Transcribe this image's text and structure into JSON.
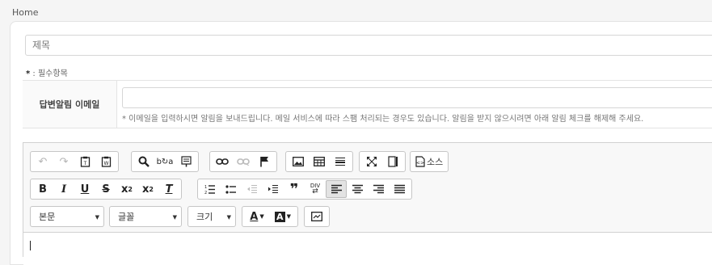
{
  "breadcrumb": {
    "home": "Home"
  },
  "form": {
    "title_placeholder": "제목",
    "required_star": "*",
    "required_text": ": 필수항목",
    "email_label": "답변알림 이메일",
    "email_hint": "* 이메일을 입력하시면 알림을 보내드립니다. 메일 서비스에 따라 스팸 처리되는 경우도 있습니다. 알림을 받지 않으시려면 아래 알림 체크를 해제해 주세요."
  },
  "editor": {
    "source_label": "소스",
    "format_combo": "본문",
    "font_combo": "글꼴",
    "size_combo": "크기",
    "text_color_glyph": "A",
    "bg_color_glyph": "A",
    "icons": {
      "bold": "B",
      "italic": "I",
      "underline": "U",
      "strike": "S",
      "subscript": "x",
      "superscript": "x",
      "remove_format": "T",
      "blockquote": "❞",
      "div": "DIV"
    }
  }
}
